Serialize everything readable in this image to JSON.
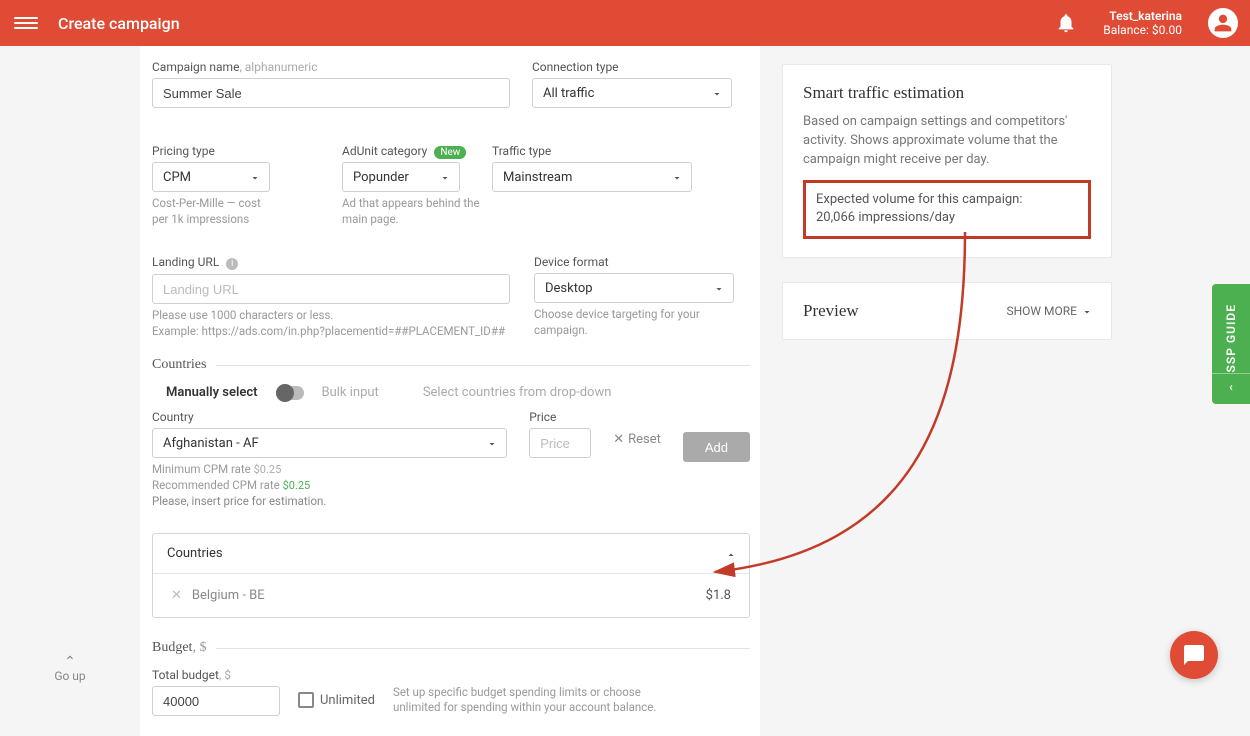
{
  "header": {
    "title": "Create campaign",
    "user_name": "Test_katerina",
    "balance": "Balance: $0.00"
  },
  "campaign": {
    "name_label": "Campaign name",
    "name_hint": ", alphanumeric",
    "name_value": "Summer Sale",
    "conn_label": "Connection type",
    "conn_value": "All traffic",
    "pricing_label": "Pricing type",
    "pricing_value": "CPM",
    "pricing_help": "Cost-Per-Mille — cost per 1k impressions",
    "adunit_label": "AdUnit category",
    "adunit_badge": "New",
    "adunit_value": "Popunder",
    "adunit_help": "Ad that appears behind the main page.",
    "traffic_label": "Traffic type",
    "traffic_value": "Mainstream",
    "landing_label": "Landing URL",
    "landing_placeholder": "Landing URL",
    "landing_help1": "Please use 1000 characters or less.",
    "landing_help2": "Example: https://ads.com/in.php?placementid=##PLACEMENT_ID##",
    "device_label": "Device format",
    "device_value": "Desktop",
    "device_help": "Choose device targeting for your campaign."
  },
  "countries": {
    "section": "Countries",
    "manual": "Manually select",
    "bulk": "Bulk input",
    "bulk_help": "Select countries from drop-down",
    "country_label": "Country",
    "country_value": "Afghanistan - AF",
    "price_label": "Price",
    "price_placeholder": "Price",
    "reset": "Reset",
    "add": "Add",
    "min_rate": "Minimum CPM rate ",
    "min_rate_val": "$0.25",
    "rec_rate": "Recommended CPM rate ",
    "rec_rate_val": "$0.25",
    "est_prompt": "Please, insert price for estimation.",
    "card_hdr": "Countries",
    "item_name": "Belgium - BE",
    "item_price": "$1.8"
  },
  "budget": {
    "section": "Budget",
    "unit": ", $",
    "total_label": "Total budget",
    "total_unit": ", $",
    "total_value": "40000",
    "unlimited": "Unlimited",
    "help": "Set up specific budget spending limits or choose unlimited for spending within your account balance."
  },
  "right": {
    "est_title": "Smart traffic estimation",
    "est_desc": "Based on campaign settings and competitors' activity. Shows approximate volume that the campaign might receive per day.",
    "est_box_l1": "Expected volume for this campaign:",
    "est_box_l2": "20,066 impressions/day",
    "preview": "Preview",
    "showmore": "SHOW MORE"
  },
  "side_tab": "SSP GUIDE",
  "goup": "Go up"
}
